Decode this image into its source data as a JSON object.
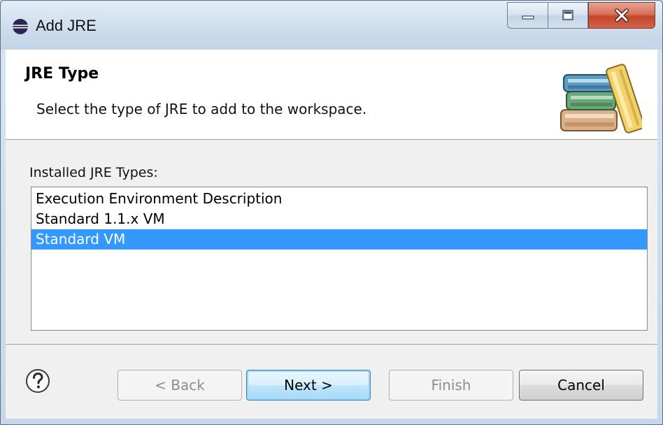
{
  "window": {
    "title": "Add JRE",
    "icon": "eclipse-icon"
  },
  "caption_buttons": {
    "minimize_icon": "minimize-icon",
    "maximize_icon": "maximize-icon",
    "close_icon": "close-icon"
  },
  "header": {
    "title": "JRE Type",
    "description": "Select the type of JRE to add to the workspace.",
    "icon": "books-icon"
  },
  "list": {
    "label": "Installed JRE Types:",
    "items": [
      {
        "label": "Execution Environment Description",
        "selected": false
      },
      {
        "label": "Standard 1.1.x VM",
        "selected": false
      },
      {
        "label": "Standard VM",
        "selected": true
      }
    ]
  },
  "footer": {
    "help_icon": "help-icon",
    "back_label": "< Back",
    "next_label": "Next >",
    "finish_label": "Finish",
    "cancel_label": "Cancel"
  },
  "colors": {
    "selection": "#3399ff",
    "close_button": "#c5452b"
  }
}
